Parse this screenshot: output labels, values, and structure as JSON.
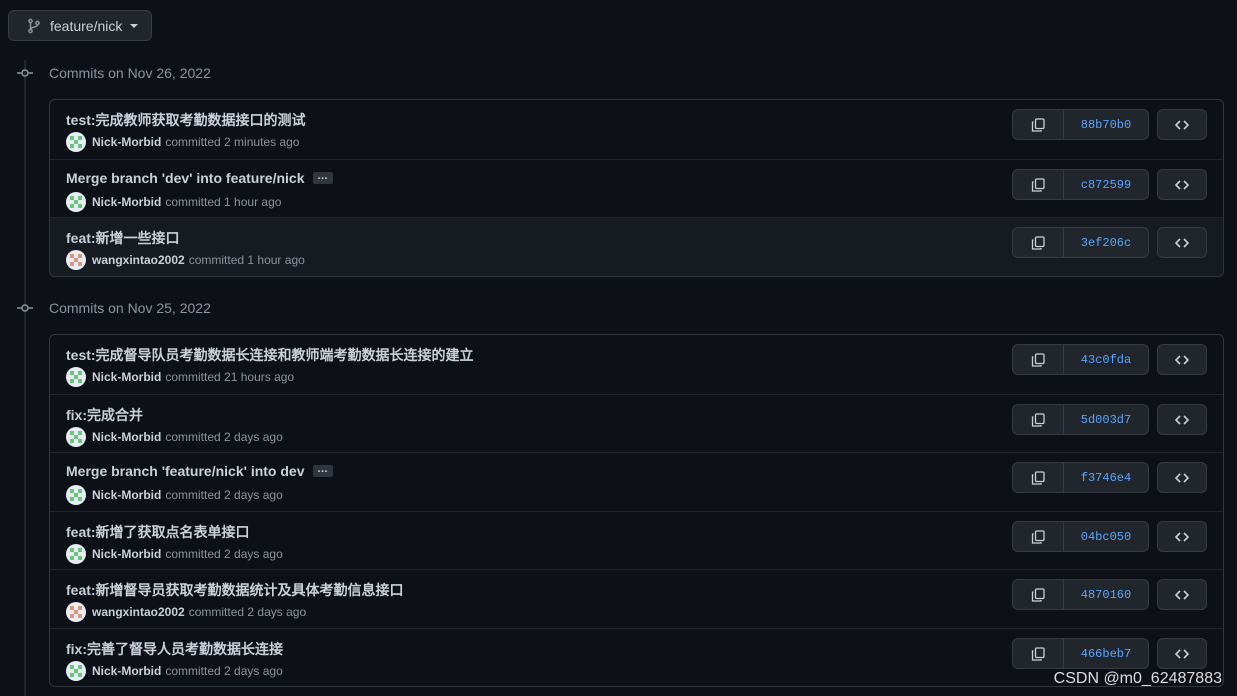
{
  "branch": {
    "name": "feature/nick"
  },
  "groups": [
    {
      "title": "Commits on Nov 26, 2022",
      "commits": [
        {
          "title": "test:完成教师获取考勤数据接口的测试",
          "author": "Nick-Morbid",
          "action": "committed",
          "time": "2 minutes ago",
          "sha": "88b70b0",
          "has_more": false,
          "avatar_color": "#6cc57c"
        },
        {
          "title": "Merge branch 'dev' into feature/nick",
          "author": "Nick-Morbid",
          "action": "committed",
          "time": "1 hour ago",
          "sha": "c872599",
          "has_more": true,
          "avatar_color": "#6cc57c"
        },
        {
          "title": "feat:新增一些接口",
          "author": "wangxintao2002",
          "action": "committed",
          "time": "1 hour ago",
          "sha": "3ef206c",
          "has_more": false,
          "avatar_color": "#e0927a"
        }
      ]
    },
    {
      "title": "Commits on Nov 25, 2022",
      "commits": [
        {
          "title": "test:完成督导队员考勤数据长连接和教师端考勤数据长连接的建立",
          "author": "Nick-Morbid",
          "action": "committed",
          "time": "21 hours ago",
          "sha": "43c0fda",
          "has_more": false,
          "avatar_color": "#6cc57c"
        },
        {
          "title": "fix:完成合并",
          "author": "Nick-Morbid",
          "action": "committed",
          "time": "2 days ago",
          "sha": "5d003d7",
          "has_more": false,
          "avatar_color": "#6cc57c"
        },
        {
          "title": "Merge branch 'feature/nick' into dev",
          "author": "Nick-Morbid",
          "action": "committed",
          "time": "2 days ago",
          "sha": "f3746e4",
          "has_more": true,
          "avatar_color": "#6cc57c"
        },
        {
          "title": "feat:新增了获取点名表单接口",
          "author": "Nick-Morbid",
          "action": "committed",
          "time": "2 days ago",
          "sha": "04bc050",
          "has_more": false,
          "avatar_color": "#6cc57c"
        },
        {
          "title": "feat:新增督导员获取考勤数据统计及具体考勤信息接口",
          "author": "wangxintao2002",
          "action": "committed",
          "time": "2 days ago",
          "sha": "4870160",
          "has_more": false,
          "avatar_color": "#e0927a"
        },
        {
          "title": "fix:完善了督导人员考勤数据长连接",
          "author": "Nick-Morbid",
          "action": "committed",
          "time": "2 days ago",
          "sha": "466beb7",
          "has_more": false,
          "avatar_color": "#6cc57c"
        }
      ]
    }
  ],
  "ellipsis_label": "…",
  "watermark": "CSDN @m0_62487883",
  "colors": {
    "accent": "#58a6ff",
    "background": "#0d1117",
    "button": "#21262d"
  }
}
